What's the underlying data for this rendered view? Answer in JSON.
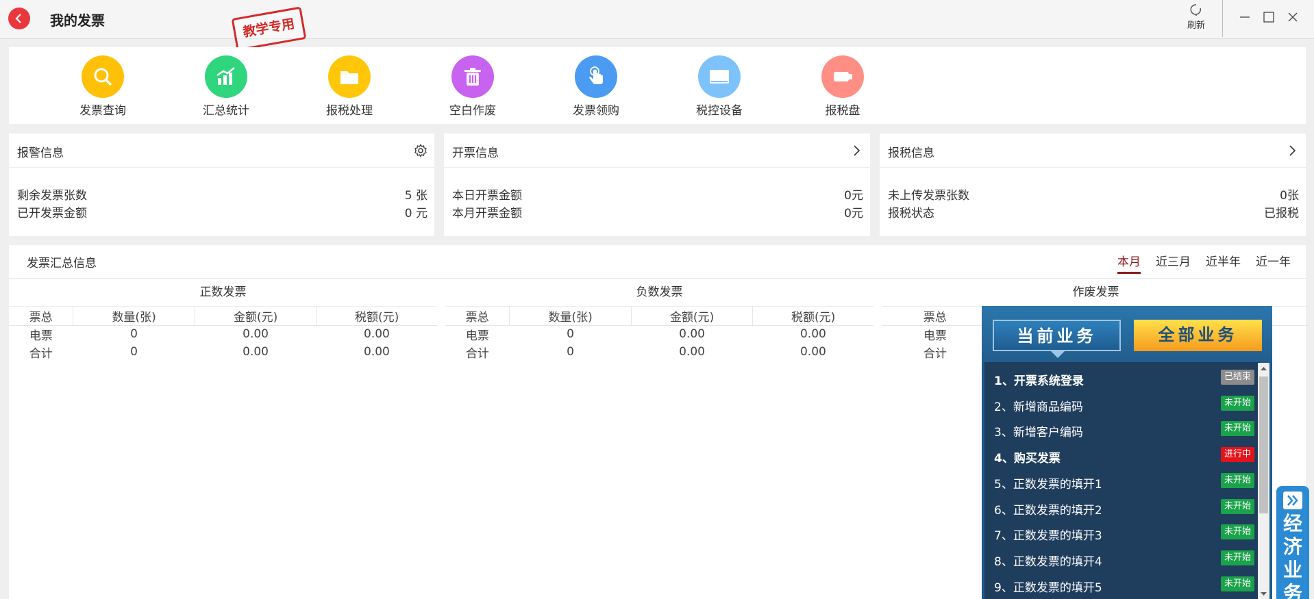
{
  "window": {
    "title": "我的发票",
    "stamp": "教学专用",
    "refresh_label": "刷新"
  },
  "tools": [
    {
      "label": "发票查询",
      "color": "#ffc107",
      "icon": "search-icon"
    },
    {
      "label": "汇总统计",
      "color": "#2fd67d",
      "icon": "chart-icon"
    },
    {
      "label": "报税处理",
      "color": "#ffc60a",
      "icon": "folder-icon"
    },
    {
      "label": "空白作废",
      "color": "#c862f0",
      "icon": "trash-icon"
    },
    {
      "label": "发票领购",
      "color": "#4b9bf2",
      "icon": "hand-pointer-icon"
    },
    {
      "label": "税控设备",
      "color": "#7ec2fb",
      "icon": "device-icon"
    },
    {
      "label": "报税盘",
      "color": "#ff8f85",
      "icon": "usb-key-icon"
    }
  ],
  "cards": {
    "alarm": {
      "title": "报警信息",
      "rows": [
        {
          "label": "剩余发票张数",
          "value": "5 张"
        },
        {
          "label": "已开发票金额",
          "value": "0 元"
        }
      ]
    },
    "invoice": {
      "title": "开票信息",
      "rows": [
        {
          "label": "本日开票金额",
          "value": "0元"
        },
        {
          "label": "本月开票金额",
          "value": "0元"
        }
      ]
    },
    "tax": {
      "title": "报税信息",
      "rows": [
        {
          "label": "未上传发票张数",
          "value": "0张"
        },
        {
          "label": "报税状态",
          "value": "已报税"
        }
      ]
    }
  },
  "summary": {
    "title": "发票汇总信息",
    "periods": [
      "本月",
      "近三月",
      "近半年",
      "近一年"
    ],
    "active_period": "本月",
    "groups": [
      {
        "title": "正数发票",
        "headers": [
          "票总",
          "数量(张)",
          "金额(元)",
          "税额(元)"
        ],
        "rows": [
          [
            "电票",
            "0",
            "0.00",
            "0.00"
          ],
          [
            "合计",
            "0",
            "0.00",
            "0.00"
          ]
        ]
      },
      {
        "title": "负数发票",
        "headers": [
          "票总",
          "数量(张)",
          "金额(元)",
          "税额(元)"
        ],
        "rows": [
          [
            "电票",
            "0",
            "0.00",
            "0.00"
          ],
          [
            "合计",
            "0",
            "0.00",
            "0.00"
          ]
        ]
      },
      {
        "title": "作废发票",
        "headers": [
          "票总"
        ],
        "rows": [
          [
            "电票"
          ],
          [
            "合计"
          ]
        ]
      }
    ]
  },
  "business": {
    "tab_current": "当前业务",
    "tab_all": "全部业务",
    "side_label": "经济业务",
    "tasks": [
      {
        "name": "1、开票系统登录",
        "status": "已结束",
        "bold": true,
        "color": "#8c8c8c"
      },
      {
        "name": "2、新增商品编码",
        "status": "未开始",
        "bold": false,
        "color": "#1aa34a"
      },
      {
        "name": "3、新增客户编码",
        "status": "未开始",
        "bold": false,
        "color": "#1aa34a"
      },
      {
        "name": "4、购买发票",
        "status": "进行中",
        "bold": true,
        "color": "#e3131b"
      },
      {
        "name": "5、正数发票的填开1",
        "status": "未开始",
        "bold": false,
        "color": "#1aa34a"
      },
      {
        "name": "6、正数发票的填开2",
        "status": "未开始",
        "bold": false,
        "color": "#1aa34a"
      },
      {
        "name": "7、正数发票的填开3",
        "status": "未开始",
        "bold": false,
        "color": "#1aa34a"
      },
      {
        "name": "8、正数发票的填开4",
        "status": "未开始",
        "bold": false,
        "color": "#1aa34a"
      },
      {
        "name": "9、正数发票的填开5",
        "status": "未开始",
        "bold": false,
        "color": "#1aa34a"
      }
    ]
  }
}
